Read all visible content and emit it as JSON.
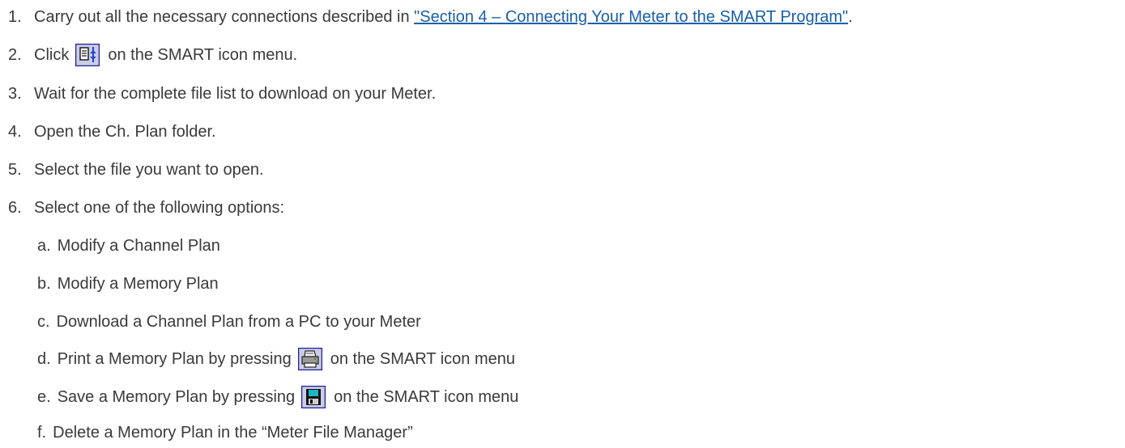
{
  "steps": [
    {
      "num": "1.",
      "before": "Carry out all the necessary connections described in ",
      "link": "\"Section 4 – Connecting Your Meter to the SMART Program\"",
      "after": "."
    },
    {
      "num": "2.",
      "before": "Click",
      "icon": "file-manager-icon",
      "after": "on the SMART icon menu."
    },
    {
      "num": "3.",
      "text": "Wait for the complete file list to download on your Meter."
    },
    {
      "num": "4.",
      "text": "Open the Ch. Plan folder."
    },
    {
      "num": "5.",
      "text": "Select the file you want to open."
    },
    {
      "num": "6.",
      "text": "Select one of the following options:"
    }
  ],
  "options": [
    {
      "num": "a.",
      "text": "Modify a Channel Plan"
    },
    {
      "num": "b.",
      "text": "Modify a Memory Plan"
    },
    {
      "num": "c.",
      "text": "Download a Channel Plan from a PC to your Meter"
    },
    {
      "num": "d.",
      "before": "Print a Memory Plan by pressing",
      "icon": "printer-icon",
      "after": "on the SMART icon menu"
    },
    {
      "num": "e.",
      "before": "Save a Memory Plan by pressing",
      "icon": "save-icon",
      "after": "on the SMART icon menu"
    },
    {
      "num": "f.",
      "text": "Delete a Memory Plan in the “Meter File Manager”"
    }
  ],
  "colors": {
    "text": "#3a3a3a",
    "link": "#1a5fa8",
    "icon_border": "#1f1f8f",
    "icon_face": "#c9cde8"
  }
}
